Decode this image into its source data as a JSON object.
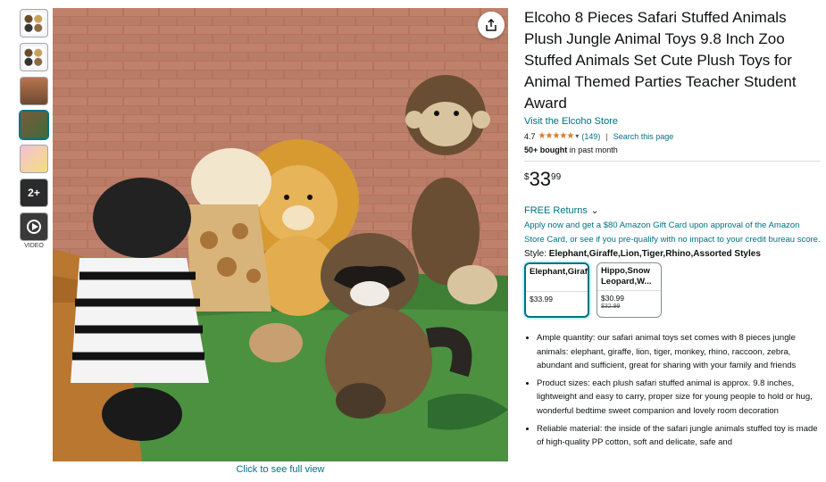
{
  "thumbnails": {
    "more_label": "2+",
    "video_label": "VIDEO"
  },
  "main_image": {
    "click_label": "Click to see full view"
  },
  "product": {
    "title": "Elcoho 8 Pieces Safari Stuffed Animals Plush Jungle Animal Toys 9.8 Inch Zoo Stuffed Animals Set Cute Plush Toys for Animal Themed Parties Teacher Student Award",
    "store_link": "Visit the Elcoho Store",
    "rating": "4.7",
    "rating_stars_value": 4.7,
    "ratings_count": "(149)",
    "search_link": "Search this page",
    "bought_bold": "50+ bought",
    "bought_rest": " in past month",
    "price_symbol": "$",
    "price_whole": "33",
    "price_fraction": "99",
    "returns": "FREE Returns",
    "gift_offer": "Apply now and get a $80 Amazon Gift Card upon approval of the Amazon Store Card, or see if you pre-qualify with no impact to your credit bureau score.",
    "style_label": "Style: ",
    "style_value": "Elephant,Giraffe,Lion,Tiger,Rhino,Assorted Styles",
    "options": [
      {
        "name": "Elephant,Giraffe,Lion,T...",
        "price": "$33.99",
        "old_price": ""
      },
      {
        "name": "Hippo,Snow Leopard,W...",
        "price": "$30.99",
        "old_price": "$32.99"
      }
    ],
    "bullets": [
      "Ample quantity: our safari animal toys set comes with 8 pieces jungle animals: elephant, giraffe, lion, tiger, monkey, rhino, raccoon, zebra, abundant and sufficient, great for sharing with your family and friends",
      "Product sizes: each plush safari stuffed animal is approx. 9.8 inches, lightweight and easy to carry, proper size for young people to hold or hug, wonderful bedtime sweet companion and lovely room decoration",
      "Reliable material: the inside of the safari jungle animals stuffed toy is made of high-quality PP cotton, soft and delicate, safe and"
    ]
  },
  "colors": {
    "link": "#007185",
    "star": "#de7921",
    "text": "#0f1111"
  }
}
